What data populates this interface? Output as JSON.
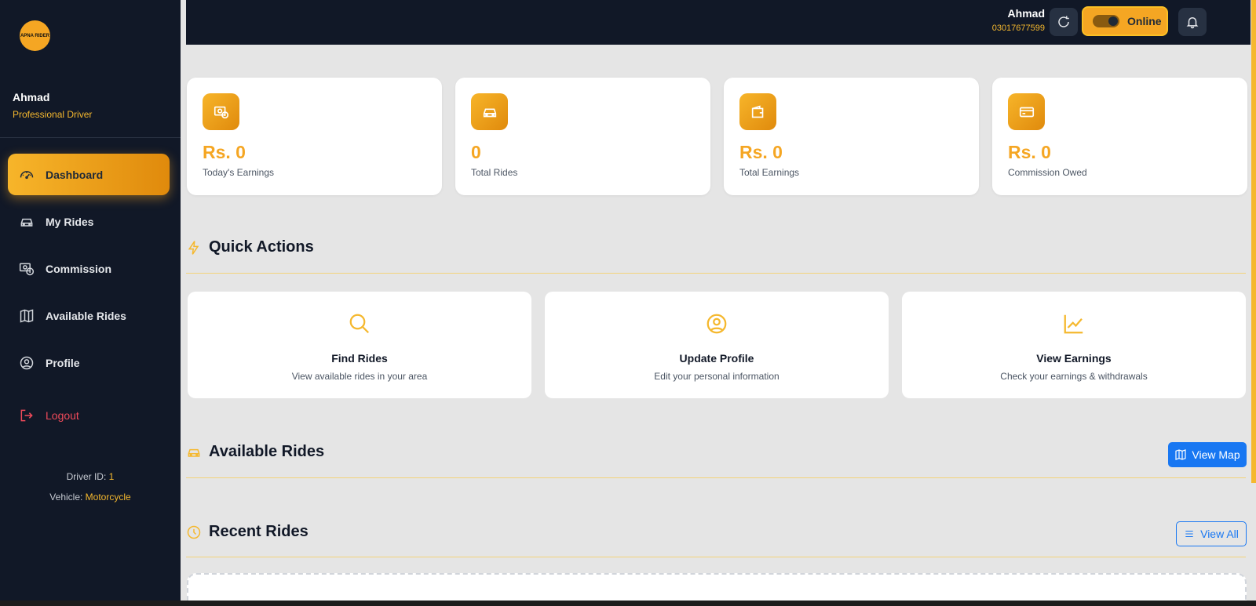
{
  "sidebar": {
    "logo_text": "APNA RIDER",
    "user_name": "Ahmad",
    "user_role": "Professional Driver",
    "items": [
      {
        "label": "Dashboard",
        "icon": "speedometer-icon",
        "active": true
      },
      {
        "label": "My Rides",
        "icon": "car-icon"
      },
      {
        "label": "Commission",
        "icon": "cash-coin-icon"
      },
      {
        "label": "Available Rides",
        "icon": "map-icon"
      },
      {
        "label": "Profile",
        "icon": "person-circle-icon"
      }
    ],
    "logout_label": "Logout",
    "driver_id_label": "Driver ID:",
    "driver_id": "1",
    "vehicle_label": "Vehicle:",
    "vehicle": "Motorcycle"
  },
  "topbar": {
    "user_name": "Ahmad",
    "phone": "03017677599",
    "status_label": "Online",
    "refresh_icon": "refresh-icon",
    "bell_icon": "bell-icon"
  },
  "stats": [
    {
      "value": "Rs. 0",
      "label": "Today's Earnings",
      "icon": "cash-icon"
    },
    {
      "value": "0",
      "label": "Total Rides",
      "icon": "car-icon"
    },
    {
      "value": "Rs. 0",
      "label": "Total Earnings",
      "icon": "wallet-icon"
    },
    {
      "value": "Rs. 0",
      "label": "Commission Owed",
      "icon": "credit-card-icon"
    }
  ],
  "quick_actions": {
    "title": "Quick Actions",
    "items": [
      {
        "title": "Find Rides",
        "subtitle": "View available rides in your area",
        "icon": "search-icon"
      },
      {
        "title": "Update Profile",
        "subtitle": "Edit your personal information",
        "icon": "person-circle-icon"
      },
      {
        "title": "View Earnings",
        "subtitle": "Check your earnings & withdrawals",
        "icon": "graph-up-icon"
      }
    ]
  },
  "available_rides": {
    "title": "Available Rides",
    "button_label": "View Map"
  },
  "recent_rides": {
    "title": "Recent Rides",
    "button_label": "View All"
  },
  "colors": {
    "accent": "#f5a623",
    "sidebar_bg": "#111827",
    "primary_blue": "#1877f2",
    "logout": "#ef4a5a"
  }
}
